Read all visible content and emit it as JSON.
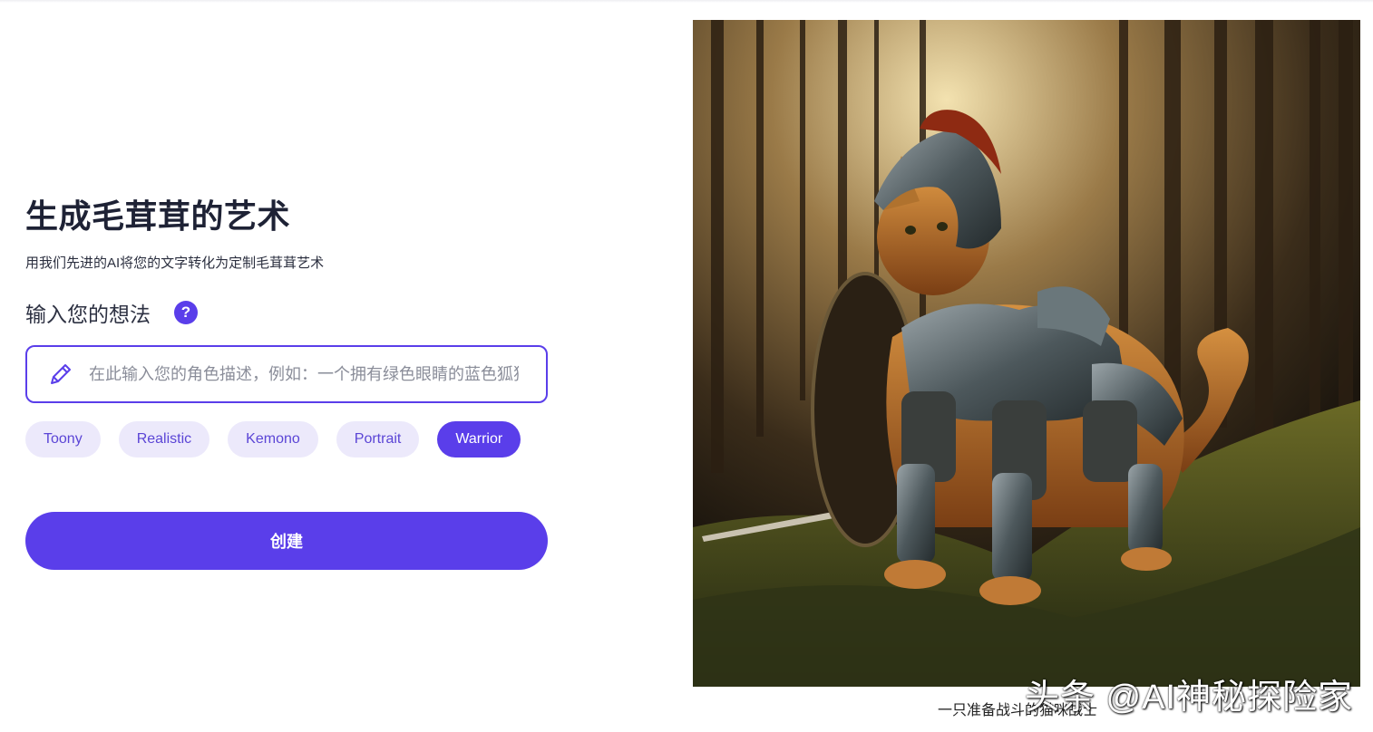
{
  "hero": {
    "title": "生成毛茸茸的艺术",
    "subtitle": "用我们先进的AI将您的文字转化为定制毛茸茸艺术"
  },
  "prompt": {
    "label": "输入您的想法",
    "help_icon": "question-icon",
    "help_glyph": "?",
    "placeholder": "在此输入您的角色描述，例如：一个拥有绿色眼睛的蓝色狐狸",
    "value": ""
  },
  "styles": [
    {
      "label": "Toony",
      "selected": false
    },
    {
      "label": "Realistic",
      "selected": false
    },
    {
      "label": "Kemono",
      "selected": false
    },
    {
      "label": "Portrait",
      "selected": false
    },
    {
      "label": "Warrior",
      "selected": true
    }
  ],
  "actions": {
    "create_label": "创建"
  },
  "result": {
    "caption": "一只准备战斗的猫咪战士",
    "watermark": "头条 @AI神秘探险家"
  },
  "colors": {
    "accent": "#5a3eea",
    "chip_bg": "#ece9fb",
    "chip_text": "#5b45d6",
    "title": "#1e2235"
  }
}
